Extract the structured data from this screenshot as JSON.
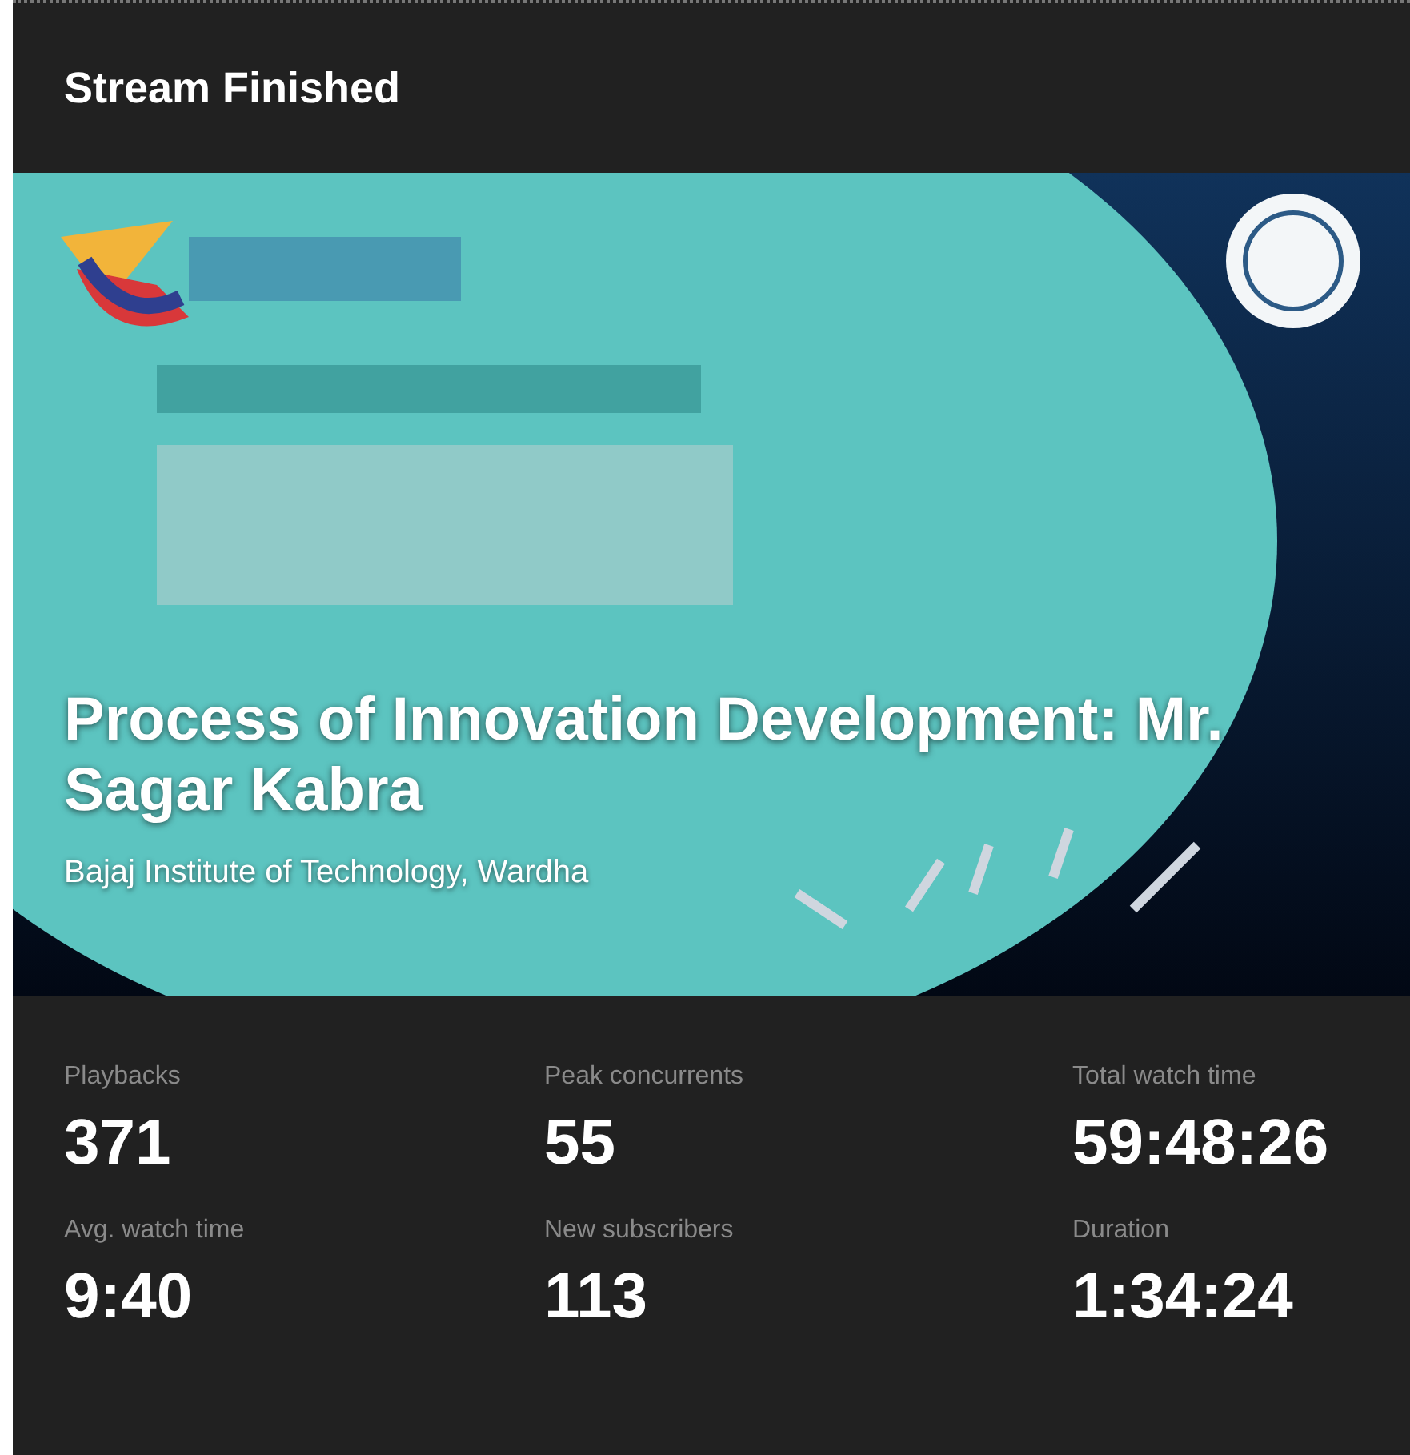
{
  "header": {
    "title": "Stream Finished"
  },
  "video": {
    "kind": "picture",
    "title": "Process of Innovation Development: Mr. Sagar Kabra",
    "subtitle": "Bajaj Institute of Technology, Wardha"
  },
  "stats": [
    {
      "label": "Playbacks",
      "value": "371"
    },
    {
      "label": "Peak concurrents",
      "value": "55"
    },
    {
      "label": "Total watch time",
      "value": "59:48:26"
    },
    {
      "label": "Avg. watch time",
      "value": "9:40"
    },
    {
      "label": "New subscribers",
      "value": "113"
    },
    {
      "label": "Duration",
      "value": "1:34:24"
    }
  ]
}
